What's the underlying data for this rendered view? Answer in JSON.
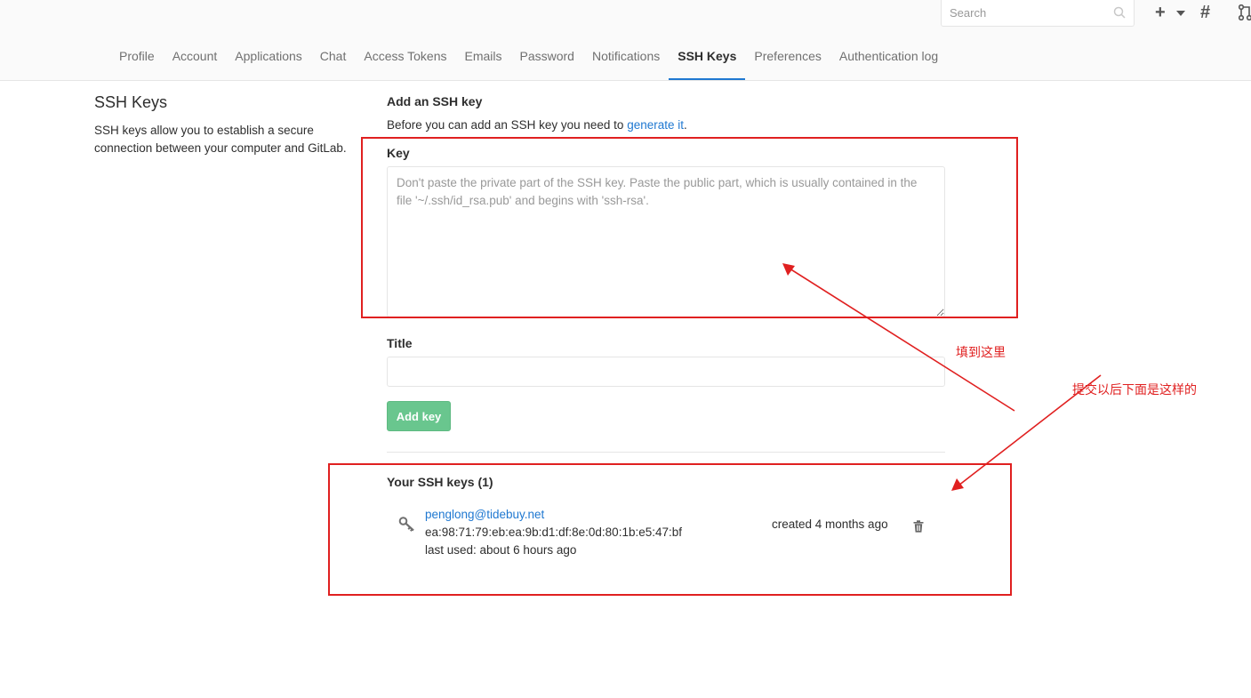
{
  "header": {
    "search": {
      "placeholder": "Search"
    },
    "icons": [
      "search-icon",
      "plus-icon",
      "chevron-down-icon",
      "hash-icon",
      "merge-request-icon"
    ]
  },
  "tabs": [
    {
      "label": "Profile"
    },
    {
      "label": "Account"
    },
    {
      "label": "Applications"
    },
    {
      "label": "Chat"
    },
    {
      "label": "Access Tokens"
    },
    {
      "label": "Emails"
    },
    {
      "label": "Password"
    },
    {
      "label": "Notifications"
    },
    {
      "label": "SSH Keys",
      "active": true
    },
    {
      "label": "Preferences"
    },
    {
      "label": "Authentication log"
    }
  ],
  "sidebar": {
    "title": "SSH Keys",
    "description": "SSH keys allow you to establish a secure connection between your computer and GitLab."
  },
  "form": {
    "heading": "Add an SSH key",
    "intro_text": "Before you can add an SSH key you need to ",
    "intro_link": "generate it",
    "intro_end": ".",
    "key_label": "Key",
    "key_placeholder": "Don't paste the private part of the SSH key. Paste the public part, which is usually contained in the file '~/.ssh/id_rsa.pub' and begins with 'ssh-rsa'.",
    "title_label": "Title",
    "title_value": "",
    "submit_label": "Add key"
  },
  "keys_list": {
    "heading": "Your SSH keys (1)",
    "items": [
      {
        "name": "penglong@tidebuy.net",
        "fingerprint": "ea:98:71:79:eb:ea:9b:d1:df:8e:0d:80:1b:e5:47:bf",
        "last_used": "last used: about 6 hours ago",
        "created": "created 4 months ago"
      }
    ]
  },
  "annotations": {
    "fill_here": "填到这里",
    "after_submit": "提交以后下面是这样的",
    "color": "#e02020"
  },
  "colors": {
    "accent": "#1f78d1",
    "success_button": "#69c68e"
  }
}
